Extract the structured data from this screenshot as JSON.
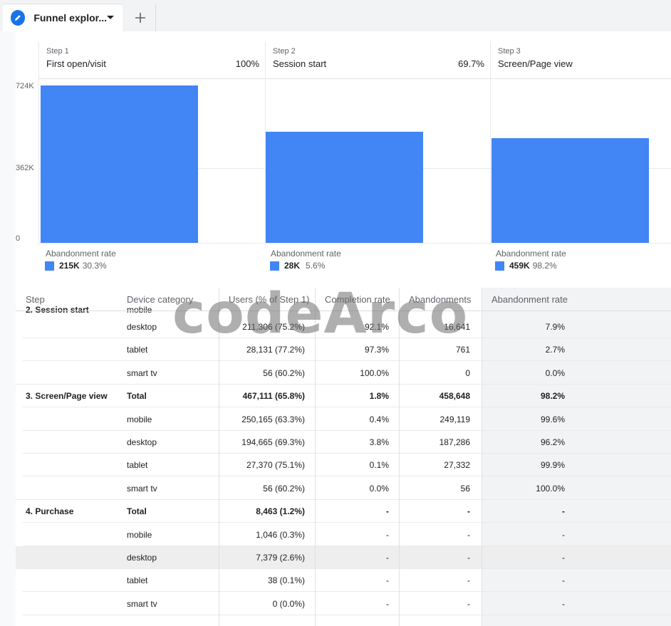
{
  "tab": {
    "title": "Funnel explor..."
  },
  "chart_data": {
    "type": "bar",
    "categories": [
      "First open/visit",
      "Session start",
      "Screen/Page view"
    ],
    "values": [
      712000,
      503000,
      474000
    ],
    "ylim": [
      0,
      724000
    ],
    "yticks": [
      "724K",
      "362K",
      "0"
    ]
  },
  "steps": [
    {
      "num": "Step 1",
      "name": "First open/visit",
      "pct": "100%",
      "abandon_label": "Abandonment rate",
      "abandon_count": "215K",
      "abandon_pct": "30.3%"
    },
    {
      "num": "Step 2",
      "name": "Session start",
      "pct": "69.7%",
      "abandon_label": "Abandonment rate",
      "abandon_count": "28K",
      "abandon_pct": "5.6%"
    },
    {
      "num": "Step 3",
      "name": "Screen/Page view",
      "pct": "",
      "abandon_label": "Abandonment rate",
      "abandon_count": "459K",
      "abandon_pct": "98.2%"
    }
  ],
  "table": {
    "headers": [
      "Step",
      "Device category",
      "Users (% of Step 1)",
      "Completion rate",
      "Abandonments",
      "Abandonment rate"
    ],
    "partial_row": {
      "step": "2. Session start",
      "device": "mobile",
      "users": "",
      "completion": "",
      "abandonments": "",
      "rate": ""
    },
    "rows": [
      {
        "step": "",
        "device": "desktop",
        "users": "211,306 (75.2%)",
        "completion": "92.1%",
        "abandonments": "16,641",
        "rate": "7.9%"
      },
      {
        "step": "",
        "device": "tablet",
        "users": "28,131 (77.2%)",
        "completion": "97.3%",
        "abandonments": "761",
        "rate": "2.7%"
      },
      {
        "step": "",
        "device": "smart tv",
        "users": "56 (60.2%)",
        "completion": "100.0%",
        "abandonments": "0",
        "rate": "0.0%"
      },
      {
        "step": "3. Screen/Page view",
        "device": "Total",
        "users": "467,111 (65.8%)",
        "completion": "1.8%",
        "abandonments": "458,648",
        "rate": "98.2%"
      },
      {
        "step": "",
        "device": "mobile",
        "users": "250,165 (63.3%)",
        "completion": "0.4%",
        "abandonments": "249,119",
        "rate": "99.6%"
      },
      {
        "step": "",
        "device": "desktop",
        "users": "194,665 (69.3%)",
        "completion": "3.8%",
        "abandonments": "187,286",
        "rate": "96.2%"
      },
      {
        "step": "",
        "device": "tablet",
        "users": "27,370 (75.1%)",
        "completion": "0.1%",
        "abandonments": "27,332",
        "rate": "99.9%"
      },
      {
        "step": "",
        "device": "smart tv",
        "users": "56 (60.2%)",
        "completion": "0.0%",
        "abandonments": "56",
        "rate": "100.0%"
      },
      {
        "step": "4. Purchase",
        "device": "Total",
        "users": "8,463 (1.2%)",
        "completion": "-",
        "abandonments": "-",
        "rate": "-"
      },
      {
        "step": "",
        "device": "mobile",
        "users": "1,046 (0.3%)",
        "completion": "-",
        "abandonments": "-",
        "rate": "-"
      },
      {
        "step": "",
        "device": "desktop",
        "users": "7,379 (2.6%)",
        "completion": "-",
        "abandonments": "-",
        "rate": "-"
      },
      {
        "step": "",
        "device": "tablet",
        "users": "38 (0.1%)",
        "completion": "-",
        "abandonments": "-",
        "rate": "-"
      },
      {
        "step": "",
        "device": "smart tv",
        "users": "0 (0.0%)",
        "completion": "-",
        "abandonments": "-",
        "rate": "-"
      }
    ]
  },
  "watermark": "codeArco"
}
